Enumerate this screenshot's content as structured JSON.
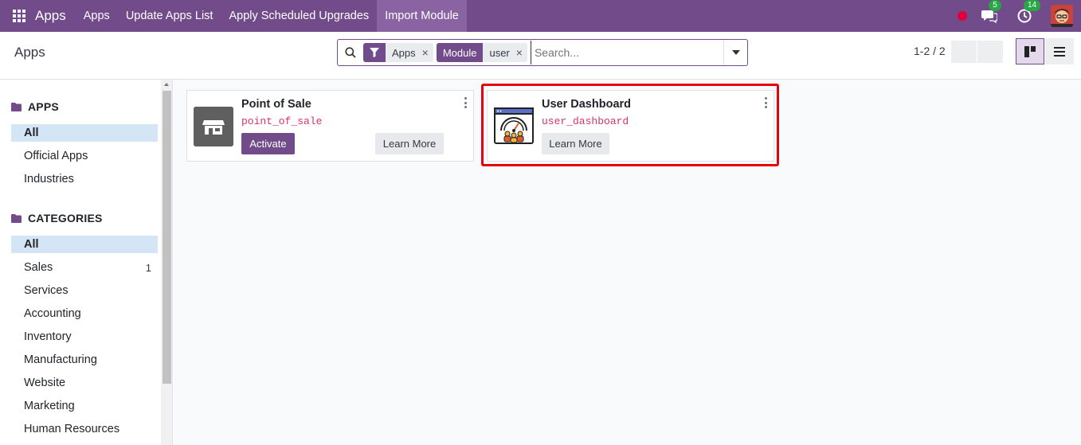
{
  "navbar": {
    "brand": "Apps",
    "menu": [
      "Apps",
      "Update Apps List",
      "Apply Scheduled Upgrades",
      "Import Module"
    ],
    "active_menu": "Import Module",
    "messages_count": "5",
    "activities_count": "14",
    "status_color": "#e0003a"
  },
  "control_panel": {
    "breadcrumb": "Apps",
    "facets": [
      {
        "label_icon": "filter-icon",
        "value": "Apps"
      },
      {
        "label": "Module",
        "value": "user"
      }
    ],
    "search_placeholder": "Search...",
    "pager": "1-2 / 2",
    "views": [
      "kanban-view-icon",
      "list-view-icon"
    ]
  },
  "sidebar": {
    "apps_header": "APPS",
    "apps_items": [
      "All",
      "Official Apps",
      "Industries"
    ],
    "categories_header": "CATEGORIES",
    "categories_items": [
      {
        "label": "All",
        "count": ""
      },
      {
        "label": "Sales",
        "count": "1"
      },
      {
        "label": "Services",
        "count": ""
      },
      {
        "label": "Accounting",
        "count": ""
      },
      {
        "label": "Inventory",
        "count": ""
      },
      {
        "label": "Manufacturing",
        "count": ""
      },
      {
        "label": "Website",
        "count": ""
      },
      {
        "label": "Marketing",
        "count": ""
      },
      {
        "label": "Human Resources",
        "count": ""
      }
    ]
  },
  "cards": [
    {
      "title": "Point of Sale",
      "technical_name": "point_of_sale",
      "primary_action": "Activate",
      "secondary_action": "Learn More",
      "icon": "store-icon"
    },
    {
      "title": "User Dashboard",
      "technical_name": "user_dashboard",
      "secondary_action": "Learn More",
      "icon": "dashboard-icon"
    }
  ],
  "colors": {
    "brand": "#714B8A",
    "highlight": "#e8000b",
    "badge": "#28a745"
  }
}
